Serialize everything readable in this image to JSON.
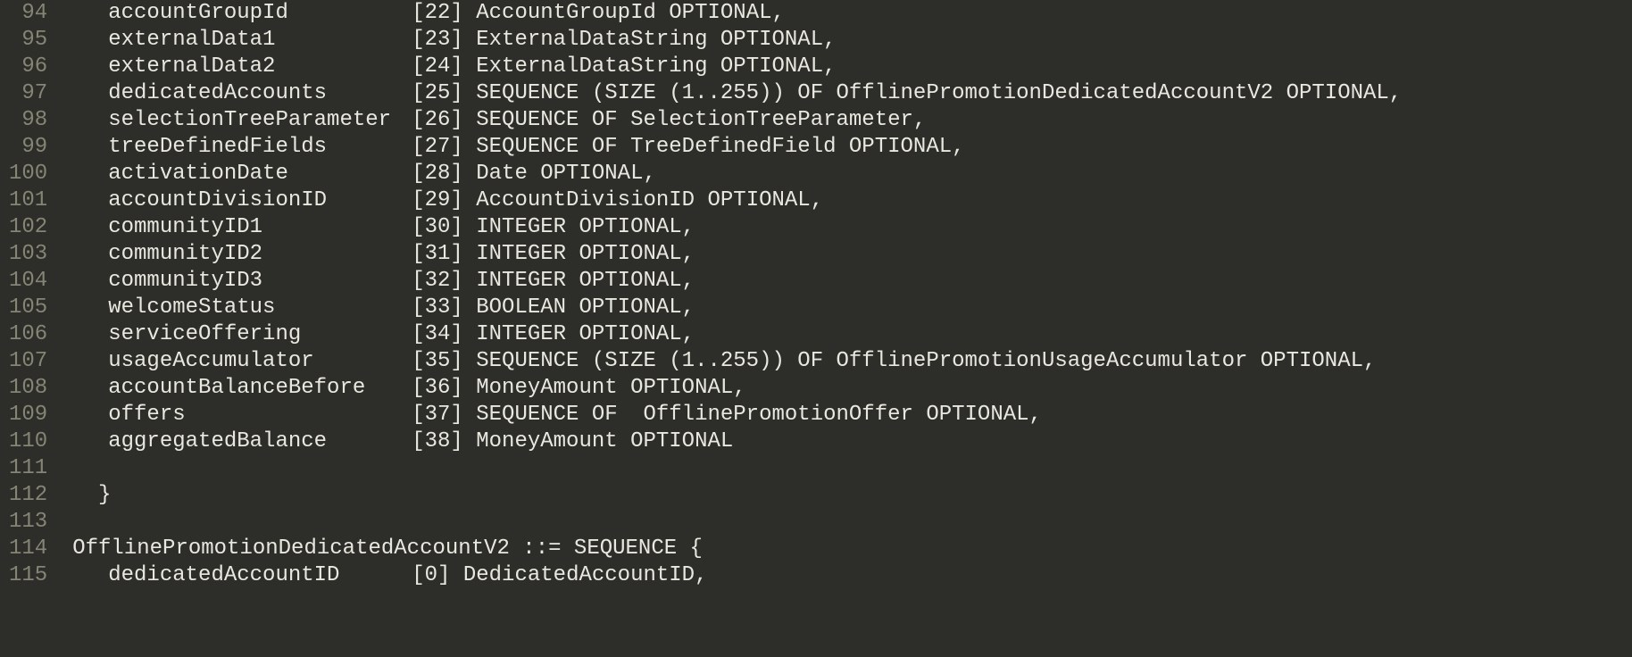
{
  "lines": [
    {
      "num": "94",
      "indent": true,
      "field": "accountGroupId",
      "tag": "[22]",
      "type": "AccountGroupId",
      "suffix": " OPTIONAL,"
    },
    {
      "num": "95",
      "indent": true,
      "field": "externalData1",
      "tag": "[23]",
      "type": "ExternalDataString",
      "suffix": " OPTIONAL,"
    },
    {
      "num": "96",
      "indent": true,
      "field": "externalData2",
      "tag": "[24]",
      "type": "ExternalDataString",
      "suffix": " OPTIONAL,"
    },
    {
      "num": "97",
      "indent": true,
      "field": "dedicatedAccounts",
      "tag": "[25]",
      "type": "SEQUENCE (SIZE (1..255)) OF OfflinePromotionDedicatedAccountV2",
      "suffix": " OPTIONAL,"
    },
    {
      "num": "98",
      "indent": true,
      "field": "selectionTreeParameter",
      "tag": "[26]",
      "type": "SEQUENCE OF SelectionTreeParameter",
      "suffix": ","
    },
    {
      "num": "99",
      "indent": true,
      "field": "treeDefinedFields",
      "tag": "[27]",
      "type": "SEQUENCE OF TreeDefinedField",
      "suffix": " OPTIONAL,"
    },
    {
      "num": "100",
      "indent": true,
      "field": "activationDate",
      "tag": "[28]",
      "type": "Date",
      "suffix": " OPTIONAL,"
    },
    {
      "num": "101",
      "indent": true,
      "field": "accountDivisionID",
      "tag": "[29]",
      "type": "AccountDivisionID",
      "suffix": " OPTIONAL,"
    },
    {
      "num": "102",
      "indent": true,
      "field": "communityID1",
      "tag": "[30]",
      "type": "INTEGER",
      "suffix": " OPTIONAL,"
    },
    {
      "num": "103",
      "indent": true,
      "field": "communityID2",
      "tag": "[31]",
      "type": "INTEGER",
      "suffix": " OPTIONAL,"
    },
    {
      "num": "104",
      "indent": true,
      "field": "communityID3",
      "tag": "[32]",
      "type": "INTEGER",
      "suffix": " OPTIONAL,"
    },
    {
      "num": "105",
      "indent": true,
      "field": "welcomeStatus",
      "tag": "[33]",
      "type": "BOOLEAN",
      "suffix": " OPTIONAL,"
    },
    {
      "num": "106",
      "indent": true,
      "field": "serviceOffering",
      "tag": "[34]",
      "type": "INTEGER",
      "suffix": " OPTIONAL,"
    },
    {
      "num": "107",
      "indent": true,
      "field": "usageAccumulator",
      "tag": "[35]",
      "type": "SEQUENCE (SIZE (1..255)) OF OfflinePromotionUsageAccumulator",
      "suffix": " OPTIONAL,"
    },
    {
      "num": "108",
      "indent": true,
      "field": "accountBalanceBefore",
      "tag": "[36]",
      "type": "MoneyAmount",
      "suffix": " OPTIONAL,"
    },
    {
      "num": "109",
      "indent": true,
      "field": "offers",
      "tag": "[37]",
      "type": "SEQUENCE OF  OfflinePromotionOffer",
      "suffix": " OPTIONAL,"
    },
    {
      "num": "110",
      "indent": true,
      "field": "aggregatedBalance",
      "tag": "[38]",
      "type": "MoneyAmount",
      "suffix": " OPTIONAL"
    },
    {
      "num": "111",
      "raw": ""
    },
    {
      "num": "112",
      "raw": "  }"
    },
    {
      "num": "113",
      "raw": ""
    },
    {
      "num": "114",
      "raw": "OfflinePromotionDedicatedAccountV2 ::= SEQUENCE {"
    },
    {
      "num": "115",
      "indent": true,
      "field": "dedicatedAccountID",
      "tag": "[0]",
      "type": "DedicatedAccountID",
      "suffix": ","
    }
  ]
}
